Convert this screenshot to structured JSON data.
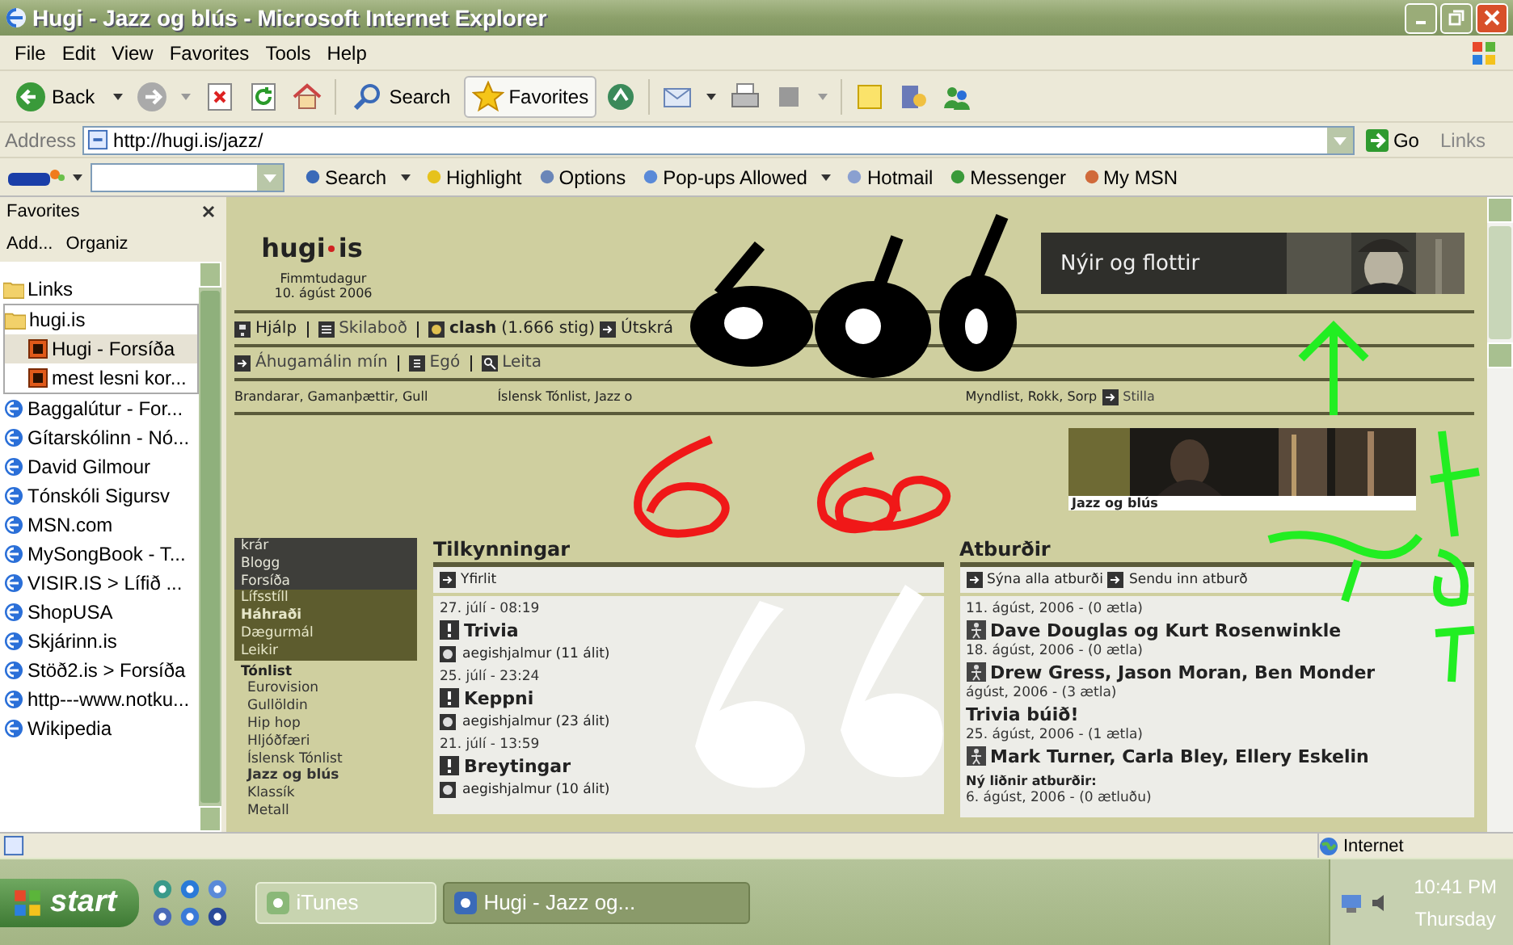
{
  "window": {
    "title": "Hugi - Jazz og blús - Microsoft Internet Explorer"
  },
  "menu": [
    "File",
    "Edit",
    "View",
    "Favorites",
    "Tools",
    "Help"
  ],
  "toolbar": {
    "back": "Back",
    "search": "Search",
    "favorites": "Favorites"
  },
  "address": {
    "label": "Address",
    "url": "http://hugi.is/jazz/",
    "go": "Go",
    "links": "Links"
  },
  "msn_bar": {
    "items": [
      "Search",
      "Highlight",
      "Options",
      "Pop-ups Allowed",
      "Hotmail",
      "Messenger",
      "My MSN"
    ]
  },
  "favorites": {
    "title": "Favorites",
    "add": "Add...",
    "organize": "Organiz",
    "items": [
      {
        "kind": "folder",
        "label": "Links",
        "expanded": false
      },
      {
        "kind": "folder",
        "label": "hugi.is",
        "expanded": true,
        "children": [
          {
            "kind": "site",
            "label": "Hugi - Forsíða",
            "selected": true
          },
          {
            "kind": "site",
            "label": "mest lesni kor...",
            "selected": false
          }
        ]
      },
      {
        "kind": "page",
        "label": "Baggalútur - For..."
      },
      {
        "kind": "page",
        "label": "Gítarskólinn - Nó..."
      },
      {
        "kind": "page",
        "label": "David Gilmour"
      },
      {
        "kind": "page",
        "label": "Tónskóli Sigursv"
      },
      {
        "kind": "page",
        "label": "MSN.com"
      },
      {
        "kind": "page",
        "label": "MySongBook - T..."
      },
      {
        "kind": "page",
        "label": "VISIR.IS > Lífið ..."
      },
      {
        "kind": "page",
        "label": "ShopUSA"
      },
      {
        "kind": "page",
        "label": "Skjárinn.is"
      },
      {
        "kind": "page",
        "label": "Stöð2.is > Forsíða"
      },
      {
        "kind": "page",
        "label": "http---www.notku..."
      },
      {
        "kind": "page",
        "label": "Wikipedia"
      }
    ]
  },
  "page": {
    "logo": [
      "hugi",
      "is"
    ],
    "day": "Fimmtudagur",
    "date": "10. ágúst 2006",
    "banner": "Nýir og flottir",
    "user_bar": {
      "help": "Hjálp",
      "messages": "Skilaboð",
      "user": "clash",
      "points": "(1.666 stig)",
      "logout": "Útskrá"
    },
    "nav2": {
      "mine": "Áhugamálin mín",
      "ego": "Egó",
      "search": "Leita"
    },
    "interests": [
      "Brandarar, Gamanþættir, Gull",
      "Íslensk Tónlist, Jazz o",
      "Myndlist, Rokk, Sorp"
    ],
    "settings": "Stilla",
    "feature": {
      "caption": "Jazz og blús"
    }
  },
  "sidebar": {
    "items": [
      {
        "kind": "dark",
        "label": "krár",
        "bold": false
      },
      {
        "kind": "dark",
        "label": "Blogg",
        "bold": false
      },
      {
        "kind": "dark",
        "label": "Forsíða",
        "bold": false
      },
      {
        "kind": "olive",
        "label": "Lífsstíll",
        "bold": false
      },
      {
        "kind": "olive",
        "label": "Háhraði",
        "bold": true
      },
      {
        "kind": "olive",
        "label": "Dægurmál",
        "bold": false
      },
      {
        "kind": "olive",
        "label": "Leikir",
        "bold": false
      },
      {
        "kind": "heading",
        "label": "Tónlist",
        "bold": true
      },
      {
        "kind": "sub",
        "label": "Eurovision",
        "bold": false
      },
      {
        "kind": "sub",
        "label": "Gullöldin",
        "bold": false
      },
      {
        "kind": "sub",
        "label": "Hip hop",
        "bold": false
      },
      {
        "kind": "sub",
        "label": "Hljóðfæri",
        "bold": false
      },
      {
        "kind": "sub",
        "label": "Íslensk Tónlist",
        "bold": false
      },
      {
        "kind": "sub",
        "label": "Jazz og blús",
        "bold": true
      },
      {
        "kind": "sub",
        "label": "Klassík",
        "bold": false
      },
      {
        "kind": "sub",
        "label": "Metall",
        "bold": false
      }
    ]
  },
  "announcements": {
    "title": "Tilkynningar",
    "overview": "Yfirlit",
    "posts": [
      {
        "date": "27. júlí - 08:19",
        "title": "Trivia",
        "meta": "aegishjalmur (11 álit)"
      },
      {
        "date": "25. júlí - 23:24",
        "title": "Keppni",
        "meta": "aegishjalmur (23 álit)"
      },
      {
        "date": "21. júlí - 13:59",
        "title": "Breytingar",
        "meta": "aegishjalmur (10 álit)"
      }
    ]
  },
  "events": {
    "title": "Atburðir",
    "links": [
      "Sýna alla atburði",
      "Sendu inn atburð"
    ],
    "items": [
      {
        "date": "11. ágúst, 2006 - (0 ætla)",
        "title": "Dave Douglas og Kurt Rosenwinkle",
        "icon": true
      },
      {
        "date": "18. ágúst, 2006 - (0 ætla)",
        "title": "Drew Gress, Jason Moran, Ben Monder",
        "icon": true
      },
      {
        "date": "ágúst, 2006 - (3 ætla)",
        "title": "Trivia búið!",
        "icon": false
      },
      {
        "date": "25. ágúst, 2006 - (1 ætla)",
        "title": "Mark Turner, Carla Bley, Ellery Eskelin",
        "icon": true
      }
    ],
    "past_title": "Ný liðnir atburðir:",
    "past": [
      "6. ágúst, 2006 - (0 ætluðu)"
    ]
  },
  "status_bar": {
    "zone": "Internet"
  },
  "taskbar": {
    "start": "start",
    "tasks": [
      {
        "label": "iTunes",
        "selected": false
      },
      {
        "label": "Hugi - Jazz og...",
        "selected": true
      }
    ],
    "time": "10:41 PM",
    "day": "Thursday"
  }
}
